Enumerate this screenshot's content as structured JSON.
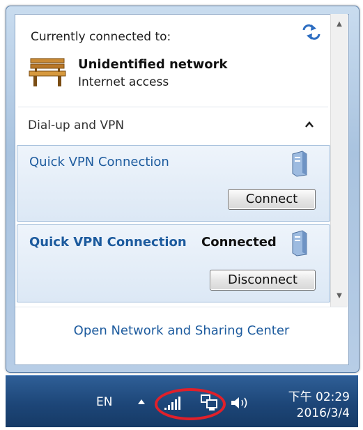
{
  "flyout": {
    "current_label": "Currently connected to:",
    "network_name": "Unidentified network",
    "network_status": "Internet access",
    "section_label": "Dial-up and VPN",
    "vpn_items": [
      {
        "name": "Quick VPN Connection",
        "state": "",
        "button_label": "Connect"
      },
      {
        "name": "Quick VPN Connection",
        "state": "Connected",
        "button_label": "Disconnect"
      }
    ],
    "footer_link": "Open Network and Sharing Center"
  },
  "taskbar": {
    "language": "EN",
    "time": "下午 02:29",
    "date": "2016/3/4"
  },
  "colors": {
    "link_blue": "#1d5b9e",
    "taskbar_blue": "#1d4678",
    "highlight_red": "#e0202a"
  },
  "icons": [
    "refresh-icon",
    "bench-network-icon",
    "collapse-icon",
    "vpn-icon",
    "signal-icon",
    "network-icon",
    "volume-icon"
  ]
}
